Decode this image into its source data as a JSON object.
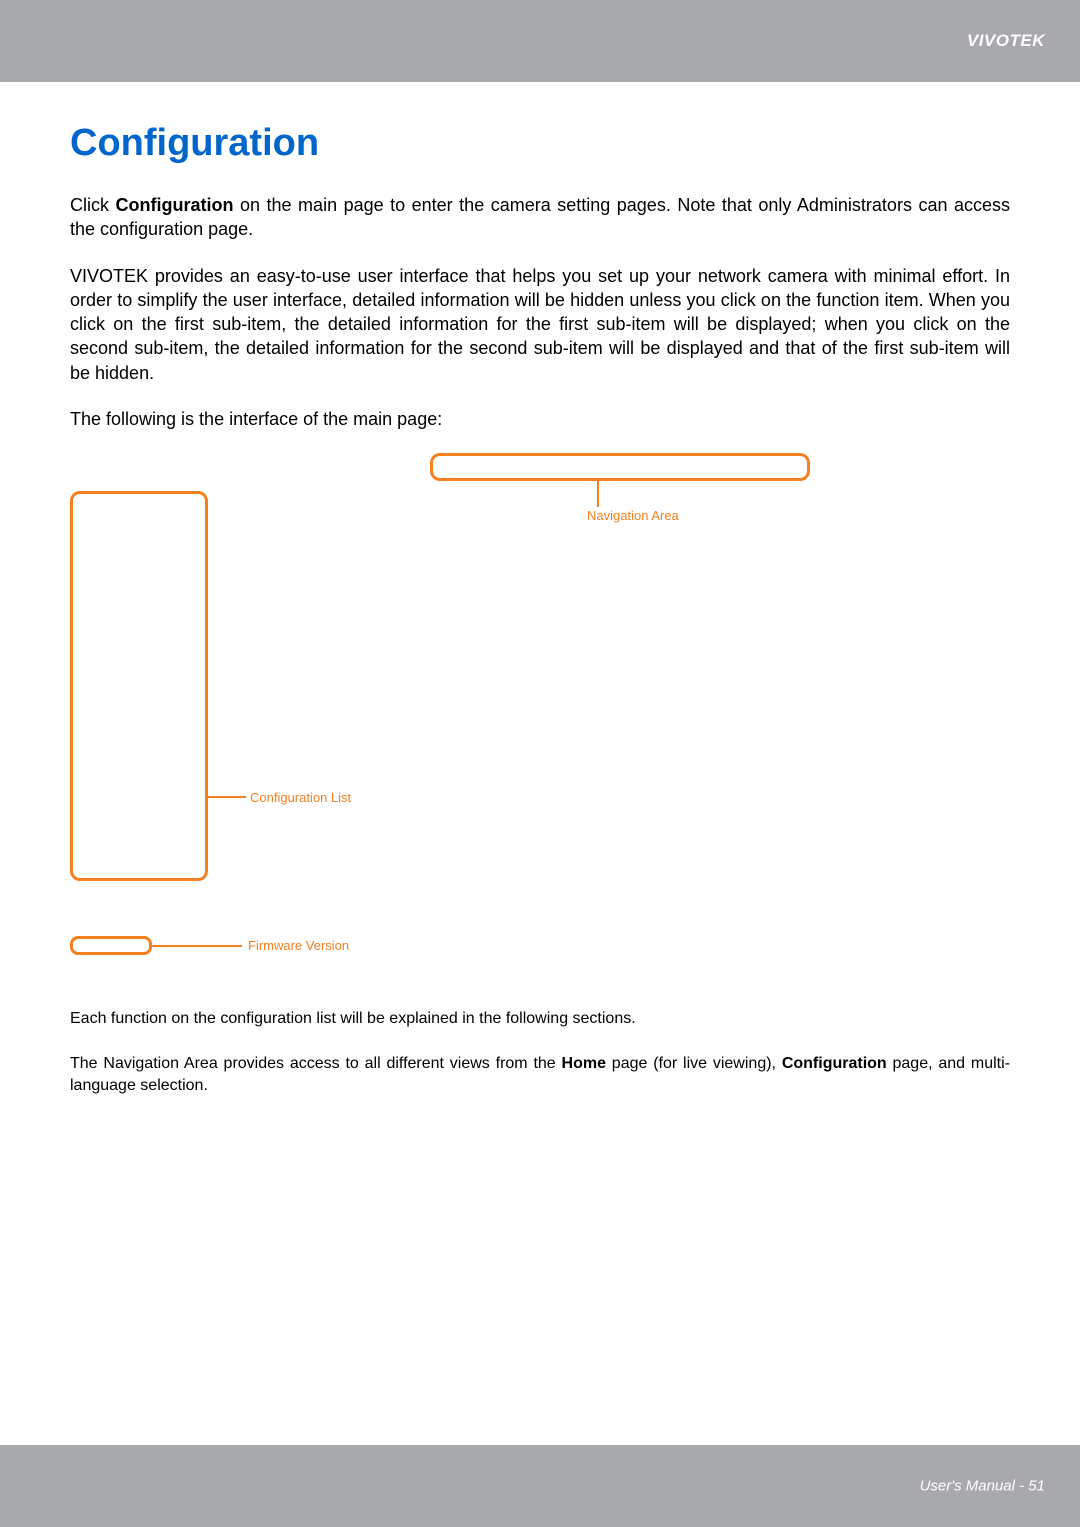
{
  "header": {
    "brand": "VIVOTEK"
  },
  "title": "Configuration",
  "paragraphs": {
    "intro1_pre": "Click ",
    "intro1_bold": "Configuration",
    "intro1_post": " on the main page to enter the camera setting pages. Note that only Administrators can access the configuration page.",
    "intro2": "VIVOTEK provides an easy-to-use user interface that helps you set up your network camera with minimal effort. In order to simplify the user interface, detailed information will be hidden unless you click on the function item. When you click on the first sub-item, the detailed information for the first sub-item will be displayed; when you click on the second sub-item, the detailed information for the second sub-item will be displayed and that of the first sub-item will be hidden.",
    "intro3": "The following is the interface of the main page:",
    "post1": "Each function on the configuration list will be explained in the following sections.",
    "post2_pre": "The Navigation Area provides access to all different views from the ",
    "post2_bold1": "Home",
    "post2_mid": " page (for live viewing), ",
    "post2_bold2": "Configuration",
    "post2_post": " page, and multi-language selection."
  },
  "diagram": {
    "nav_label": "Navigation Area",
    "config_label": "Configuration List",
    "firmware_label": "Firmware Version"
  },
  "footer": {
    "text": "User's Manual - 51"
  }
}
